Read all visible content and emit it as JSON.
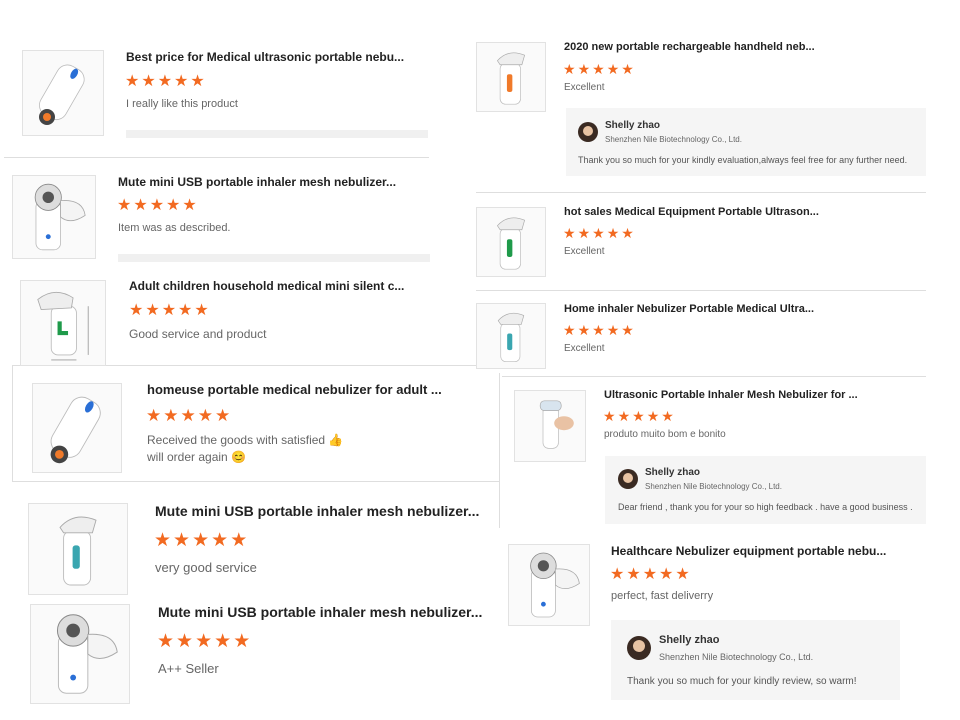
{
  "star_color": "#f26a21",
  "star_char": "★",
  "reviews": [
    {
      "title": "Best price for Medical ultrasonic portable nebu...",
      "rating": 5,
      "comment": "I really like this product",
      "image": "nebulizer-blue-button"
    },
    {
      "title": "Mute mini USB portable inhaler mesh nebulizer...",
      "rating": 5,
      "comment": "Item was as described.",
      "image": "nebulizer-mask"
    },
    {
      "title": "Adult children household medical mini silent c...",
      "rating": 5,
      "comment": "Good service and product",
      "image": "nebulizer-dimensions"
    },
    {
      "title": "homeuse portable medical nebulizer for adult ...",
      "rating": 5,
      "comment": "Received the goods with satisfied 👍",
      "comment2": "will order again 😊",
      "image": "nebulizer-blue-button"
    },
    {
      "title": "Mute mini USB portable inhaler mesh nebulizer...",
      "rating": 5,
      "comment": "very good service",
      "image": "nebulizer-teal"
    },
    {
      "title": "Mute mini USB portable inhaler mesh nebulizer...",
      "rating": 5,
      "comment": "A++ Seller",
      "image": "nebulizer-mask"
    },
    {
      "title": "2020 new portable rechargeable handheld neb...",
      "rating": 5,
      "comment": "Excellent",
      "image": "nebulizer-orange"
    },
    {
      "title": "hot sales Medical Equipment Portable Ultrason...",
      "rating": 5,
      "comment": "Excellent",
      "image": "nebulizer-green"
    },
    {
      "title": "Home inhaler Nebulizer Portable Medical Ultra...",
      "rating": 5,
      "comment": "Excellent",
      "image": "nebulizer-teal"
    },
    {
      "title": "Ultrasonic Portable Inhaler Mesh Nebulizer for ...",
      "rating": 5,
      "comment": "produto muito bom e bonito",
      "image": "nebulizer-hand"
    },
    {
      "title": "Healthcare Nebulizer equipment portable nebu...",
      "rating": 5,
      "comment": "perfect, fast deliverry",
      "image": "nebulizer-mask"
    }
  ],
  "replies": [
    {
      "name": "Shelly zhao",
      "company": "Shenzhen Nile Biotechnology Co., Ltd.",
      "text": "Thank you so much for your kindly  evaluation,always feel free for any further need."
    },
    {
      "name": "Shelly zhao",
      "company": "Shenzhen Nile Biotechnology Co., Ltd.",
      "text": "Dear friend , thank you for your so high feedback . have a good business ."
    },
    {
      "name": "Shelly zhao",
      "company": "Shenzhen Nile Biotechnology Co., Ltd.",
      "text": "Thank you so much for your kindly  review, so warm!"
    }
  ]
}
